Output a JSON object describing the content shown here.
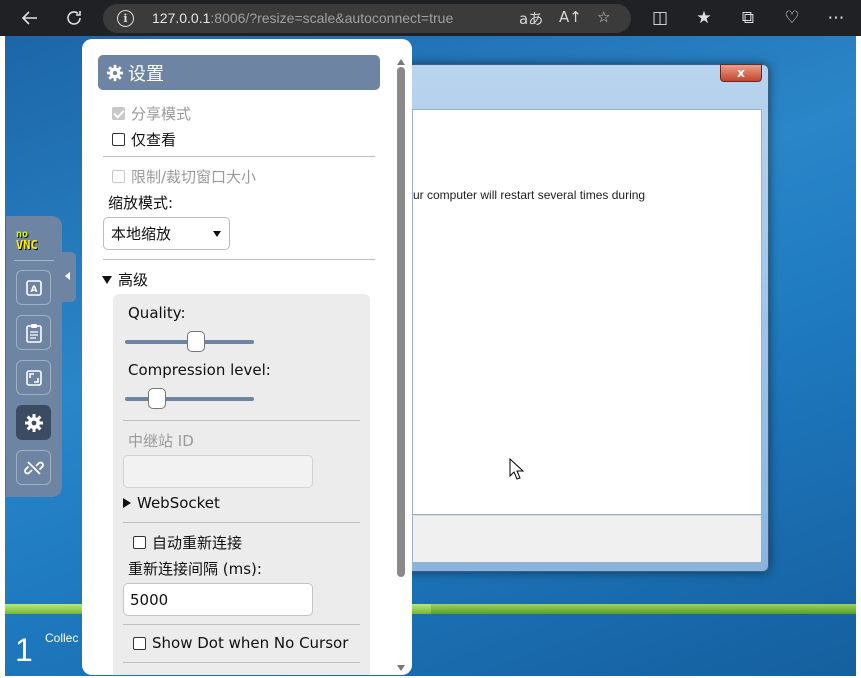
{
  "browser": {
    "url_host": "127.0.0.1",
    "url_rest": ":8006/?resize=scale&autoconnect=true"
  },
  "remote": {
    "dialog_text": "ur computer will restart several times during",
    "close_label": "x",
    "step_number": "1",
    "collect_text": "Collec",
    "progress_fraction": 0.5
  },
  "settings": {
    "title": "设置",
    "shared_mode": "分享模式",
    "view_only": "仅查看",
    "clip_resize": "限制/裁切窗口大小",
    "scaling_mode_label": "缩放模式:",
    "scaling_mode_value": "本地缩放",
    "advanced": "高级",
    "quality_label": "Quality:",
    "quality_value": 0.55,
    "compression_label": "Compression level:",
    "compression_value": 0.25,
    "repeater_label": "中继站 ID",
    "repeater_value": "",
    "websocket": "WebSocket",
    "auto_reconnect": "自动重新连接",
    "reconnect_delay_label": "重新连接间隔 (ms):",
    "reconnect_delay_value": "5000",
    "show_dot": "Show Dot when No Cursor"
  },
  "colors": {
    "accent": "#6e84a3",
    "accent_dark": "#3b4c62"
  }
}
